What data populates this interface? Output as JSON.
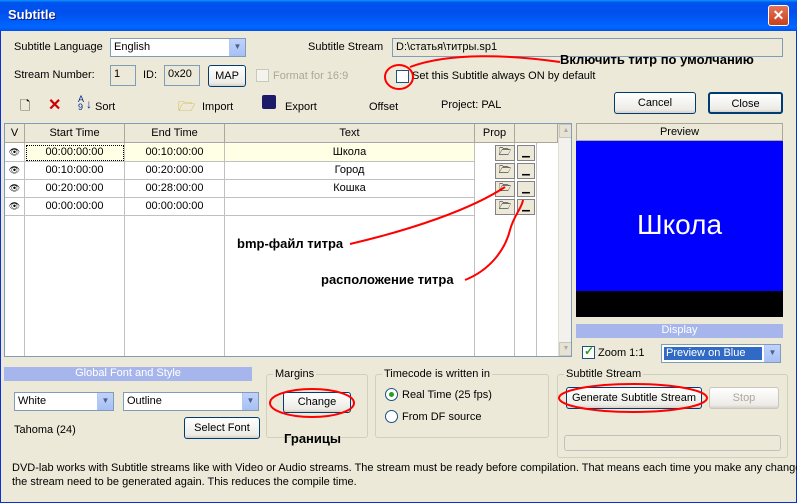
{
  "window": {
    "title": "Subtitle",
    "close_glyph": "✕"
  },
  "top": {
    "language_label": "Subtitle Language",
    "language_value": "English",
    "stream_label": "Subtitle Stream",
    "stream_value": "D:\\статья\\титры.sp1",
    "stream_number_label": "Stream Number:",
    "stream_number_value": "1",
    "id_label": "ID:",
    "id_value": "0x20",
    "map_button": "MAP",
    "format_label": "Format for 16:9",
    "format_checked": false,
    "always_on_label": "Set this Subtitle always ON by default",
    "always_on_checked": false
  },
  "toolbar": {
    "sort_label": "Sort",
    "import_label": "Import",
    "export_label": "Export",
    "offset_label": "Offset",
    "project_label": "Project: PAL",
    "cancel_button": "Cancel",
    "close_button": "Close"
  },
  "grid": {
    "columns": [
      "V",
      "Start Time",
      "End Time",
      "Text",
      "Prop"
    ],
    "rows": [
      {
        "start": "00:00:00:00",
        "end": "00:10:00:00",
        "text": "Школа"
      },
      {
        "start": "00:10:00:00",
        "end": "00:20:00:00",
        "text": "Город"
      },
      {
        "start": "00:20:00:00",
        "end": "00:28:00:00",
        "text": "Кошка"
      },
      {
        "start": "00:00:00:00",
        "end": "00:00:00:00",
        "text": ""
      }
    ]
  },
  "preview": {
    "header": "Preview",
    "text": "Школа",
    "display_label": "Display",
    "zoom_label": "Zoom 1:1",
    "zoom_checked": true,
    "preview_mode": "Preview on Blue"
  },
  "font": {
    "header": "Global Font and Style",
    "color_value": "White",
    "style_value": "Outline",
    "font_name": "Tahoma (24)",
    "select_font_button": "Select Font"
  },
  "margins": {
    "title": "Margins",
    "change_button": "Change"
  },
  "timecode": {
    "title": "Timecode is written in",
    "option_realtime": "Real Time (25 fps)",
    "option_df": "From DF source",
    "selected": "realtime"
  },
  "subtitle_stream": {
    "title": "Subtitle Stream",
    "generate_button": "Generate Subtitle Stream",
    "stop_button": "Stop"
  },
  "footer": {
    "line1": "DVD-lab works with Subtitle streams like with Video or Audio streams. The stream must be ready before compilation. That means each time you make any changes",
    "line2": "the stream need to be generated again. This reduces the compile time."
  },
  "annotations": {
    "default_on": "Включить титр по умолчанию",
    "bmp_file": "bmp-файл титра",
    "position": "расположение титра",
    "margins": "Границы"
  },
  "colors": {
    "annotation_red": "#FF0000",
    "preview_bg": "#0000FF",
    "title_bar": "#0053EE"
  }
}
